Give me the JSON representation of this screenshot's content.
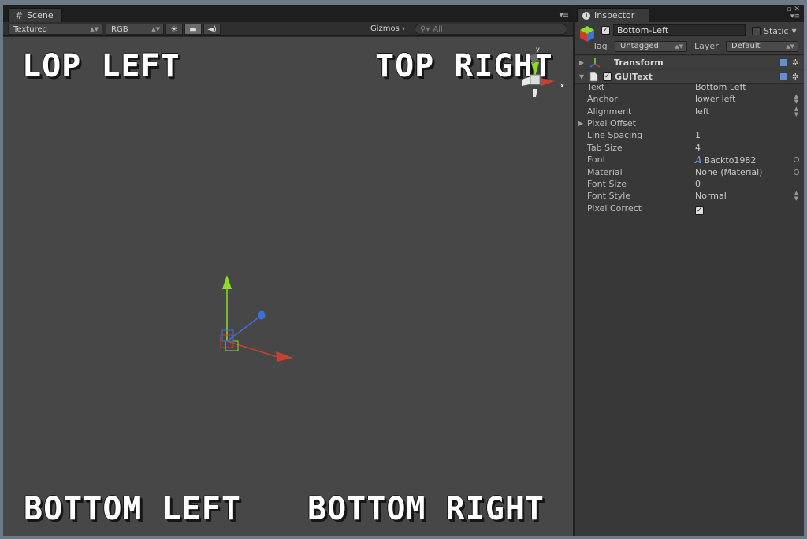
{
  "scene": {
    "tab_label": "Scene",
    "toolbar": {
      "render_mode": "Textured",
      "color_mode": "RGB",
      "gizmos_label": "Gizmos",
      "search_placeholder": "All"
    },
    "gui_texts": {
      "top_left": "LOP LEFT",
      "top_right": "TOP RIGHT",
      "bottom_left": "BOTTOM LEFT",
      "bottom_right": "BOTTOM RIGHT"
    },
    "axis_labels": {
      "x": "x",
      "y": "y"
    }
  },
  "inspector": {
    "tab_label": "Inspector",
    "object": {
      "name": "Bottom-Left",
      "active": true,
      "static_label": "Static",
      "static": false,
      "tag_label": "Tag",
      "tag_value": "Untagged",
      "layer_label": "Layer",
      "layer_value": "Default"
    },
    "components": {
      "transform": {
        "title": "Transform",
        "expanded": false
      },
      "guitext": {
        "title": "GUIText",
        "enabled": true,
        "properties": [
          {
            "name": "Text",
            "value": "Bottom Left"
          },
          {
            "name": "Anchor",
            "value": "lower left"
          },
          {
            "name": "Alignment",
            "value": "left"
          },
          {
            "name": "Pixel Offset",
            "value": ""
          },
          {
            "name": "Line Spacing",
            "value": "1"
          },
          {
            "name": "Tab Size",
            "value": "4"
          },
          {
            "name": "Font",
            "value": "Backto1982"
          },
          {
            "name": "Material",
            "value": "None (Material)"
          },
          {
            "name": "Font Size",
            "value": "0"
          },
          {
            "name": "Font Style",
            "value": "Normal"
          },
          {
            "name": "Pixel Correct",
            "value": true
          }
        ]
      }
    }
  },
  "colors": {
    "x_axis": "#c8402e",
    "y_axis": "#8ddc2c",
    "z_axis": "#3f6fd8",
    "viewport_bg": "#474747",
    "panel_bg": "#383838"
  }
}
